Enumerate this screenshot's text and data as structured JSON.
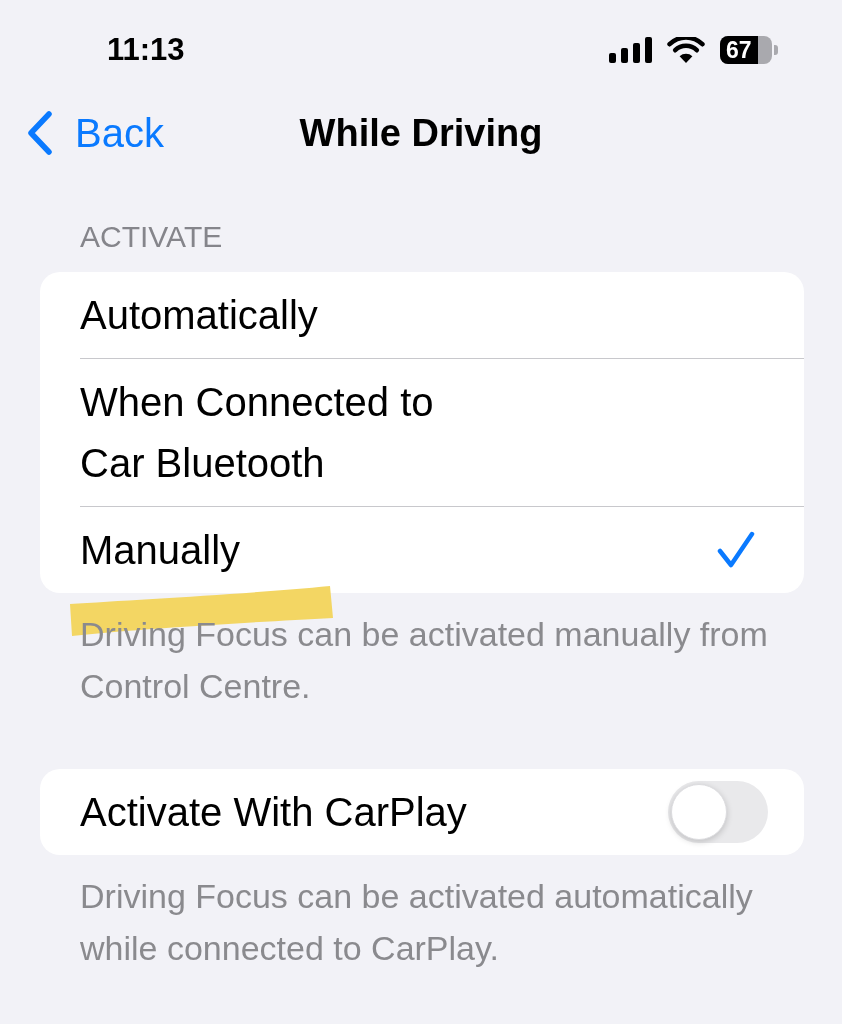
{
  "status_bar": {
    "time": "11:13",
    "battery": "67"
  },
  "nav": {
    "back": "Back",
    "title": "While Driving"
  },
  "sections": [
    {
      "header": "ACTIVATE",
      "rows": [
        {
          "kind": "choice",
          "label": "Automatically",
          "selected": false
        },
        {
          "kind": "choice",
          "label": "When Connected to Car Bluetooth",
          "selected": false
        },
        {
          "kind": "choice",
          "label": "Manually",
          "selected": true
        }
      ],
      "footer": "Driving Focus can be activated manually from Control Centre.",
      "footer_highlighted": true
    },
    {
      "rows": [
        {
          "kind": "toggle",
          "label": "Activate With CarPlay",
          "on": false
        }
      ],
      "footer": "Driving Focus can be activated automatically while connected to CarPlay."
    }
  ]
}
